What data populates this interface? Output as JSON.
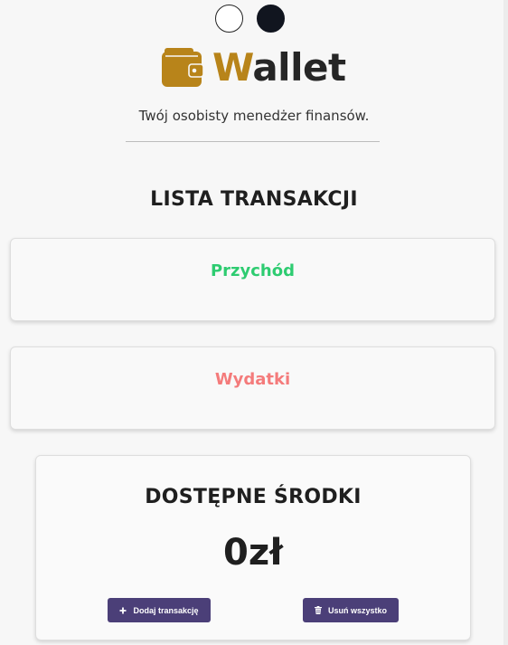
{
  "theme": {
    "light_option": "light-theme",
    "dark_option": "dark-theme"
  },
  "logo": {
    "first_letter": "W",
    "rest": "allet",
    "icon": "wallet-icon"
  },
  "subtitle": "Twój osobisty menedżer finansów.",
  "transactions": {
    "title": "LISTA TRANSAKCJI",
    "income_heading": "Przychód",
    "expense_heading": "Wydatki"
  },
  "balance": {
    "title": "DOSTĘPNE ŚRODKI",
    "amount": "0zł"
  },
  "buttons": {
    "add": {
      "label": "Dodaj transakcję",
      "icon": "plus-icon"
    },
    "delete_all": {
      "label": "Usuń wszystko",
      "icon": "trash-icon"
    }
  },
  "colors": {
    "accent": "#b8841a",
    "income": "#2ecc71",
    "expense": "#f47b7b",
    "button": "#4b3f78"
  }
}
